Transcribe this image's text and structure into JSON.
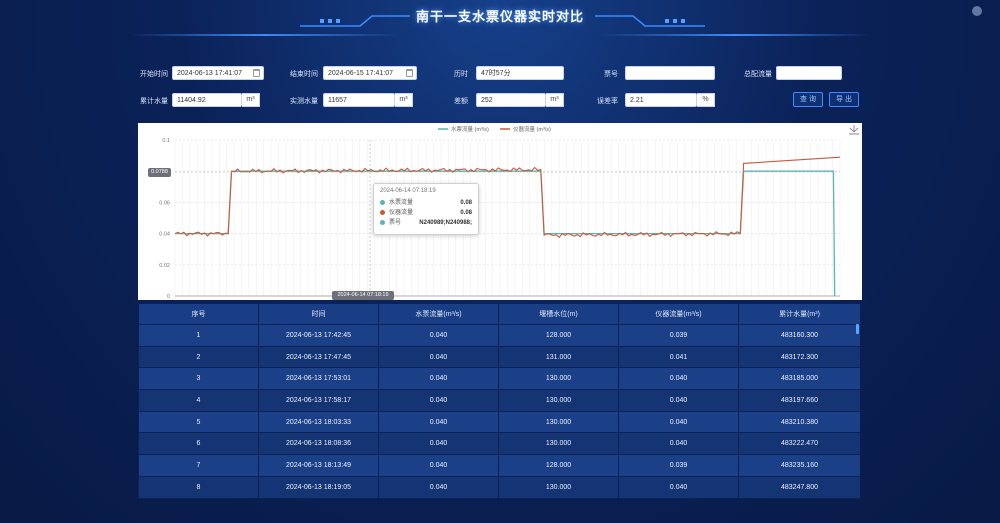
{
  "header": {
    "title": "南干一支水票仪器实时对比"
  },
  "form": {
    "start_time_label": "开始时间",
    "start_time_value": "2024-06-13 17:41:07",
    "end_time_label": "结束时间",
    "end_time_value": "2024-06-15 17:41:07",
    "duration_label": "历时",
    "duration_value": "47时57分",
    "ticket_label": "票号",
    "ticket_value": "",
    "allocated_label": "总配流量",
    "allocated_value": "",
    "cumulative_label": "累计水量",
    "cumulative_value": "11404.92",
    "cumulative_unit": "m³",
    "measured_label": "实测水量",
    "measured_value": "11657",
    "measured_unit": "m³",
    "diff_label": "差额",
    "diff_value": "252",
    "diff_unit": "m³",
    "deviation_label": "误差率",
    "deviation_value": "2.21",
    "deviation_unit": "%",
    "query_button": "查 询",
    "export_button": "导 出"
  },
  "chart_tooltip": {
    "time": "2024-06-14 07:18:19",
    "rows": [
      {
        "label": "水票流量",
        "value": "0.08",
        "color": "#5ab5b0"
      },
      {
        "label": "仪器流量",
        "value": "0.08",
        "color": "#c85a3c"
      },
      {
        "label": "票号",
        "value": "N240989;N240988;",
        "color": "#5ab5b0"
      }
    ],
    "x_pointer": "2024-06-14 07:18:19",
    "y_pointer": "0.0788"
  },
  "chart_data": {
    "type": "line",
    "legend": [
      "水票流量 (m³/s)",
      "仪器流量 (m³/s)"
    ],
    "legend_position": "top-center",
    "ylim": [
      0,
      0.1
    ],
    "yticks": [
      "0",
      "0.02",
      "0.04",
      "0.06",
      "0.08",
      "0.1"
    ],
    "grid": true,
    "series": [
      {
        "name": "水票流量 (m³/s)",
        "color": "#5ab5b0",
        "points": [
          [
            0,
            0.04
          ],
          [
            0.08,
            0.04
          ],
          [
            0.085,
            0.08
          ],
          [
            0.55,
            0.08
          ],
          [
            0.555,
            0.04
          ],
          [
            0.85,
            0.04
          ],
          [
            0.855,
            0.08
          ],
          [
            0.99,
            0.08
          ],
          [
            0.992,
            0
          ]
        ]
      },
      {
        "name": "仪器流量 (m³/s)",
        "color": "#c85a3c",
        "points": [
          [
            0,
            0.04
          ],
          [
            0.08,
            0.04
          ],
          [
            0.085,
            0.08
          ],
          [
            0.55,
            0.081
          ],
          [
            0.555,
            0.039
          ],
          [
            0.85,
            0.04
          ],
          [
            0.855,
            0.085
          ],
          [
            1.0,
            0.089
          ]
        ]
      }
    ]
  },
  "table": {
    "headers": [
      "序号",
      "时间",
      "水票流量(m³/s)",
      "堰槽水位(m)",
      "仪器流量(m³/s)",
      "累计水量(m³)"
    ],
    "rows": [
      [
        "1",
        "2024-06-13 17:42:45",
        "0.040",
        "128.000",
        "0.039",
        "483160.300"
      ],
      [
        "2",
        "2024-06-13 17:47:45",
        "0.040",
        "131.000",
        "0.041",
        "483172.300"
      ],
      [
        "3",
        "2024-06-13 17:53:01",
        "0.040",
        "130.000",
        "0.040",
        "483185.000"
      ],
      [
        "4",
        "2024-06-13 17:58:17",
        "0.040",
        "130.000",
        "0.040",
        "483197.660"
      ],
      [
        "5",
        "2024-06-13 18:03:33",
        "0.040",
        "130.000",
        "0.040",
        "483210.380"
      ],
      [
        "6",
        "2024-06-13 18:08:36",
        "0.040",
        "130.000",
        "0.040",
        "483222.470"
      ],
      [
        "7",
        "2024-06-13 18:13:49",
        "0.040",
        "128.000",
        "0.039",
        "483235.160"
      ],
      [
        "8",
        "2024-06-13 18:19:05",
        "0.040",
        "130.000",
        "0.040",
        "483247.800"
      ]
    ]
  }
}
